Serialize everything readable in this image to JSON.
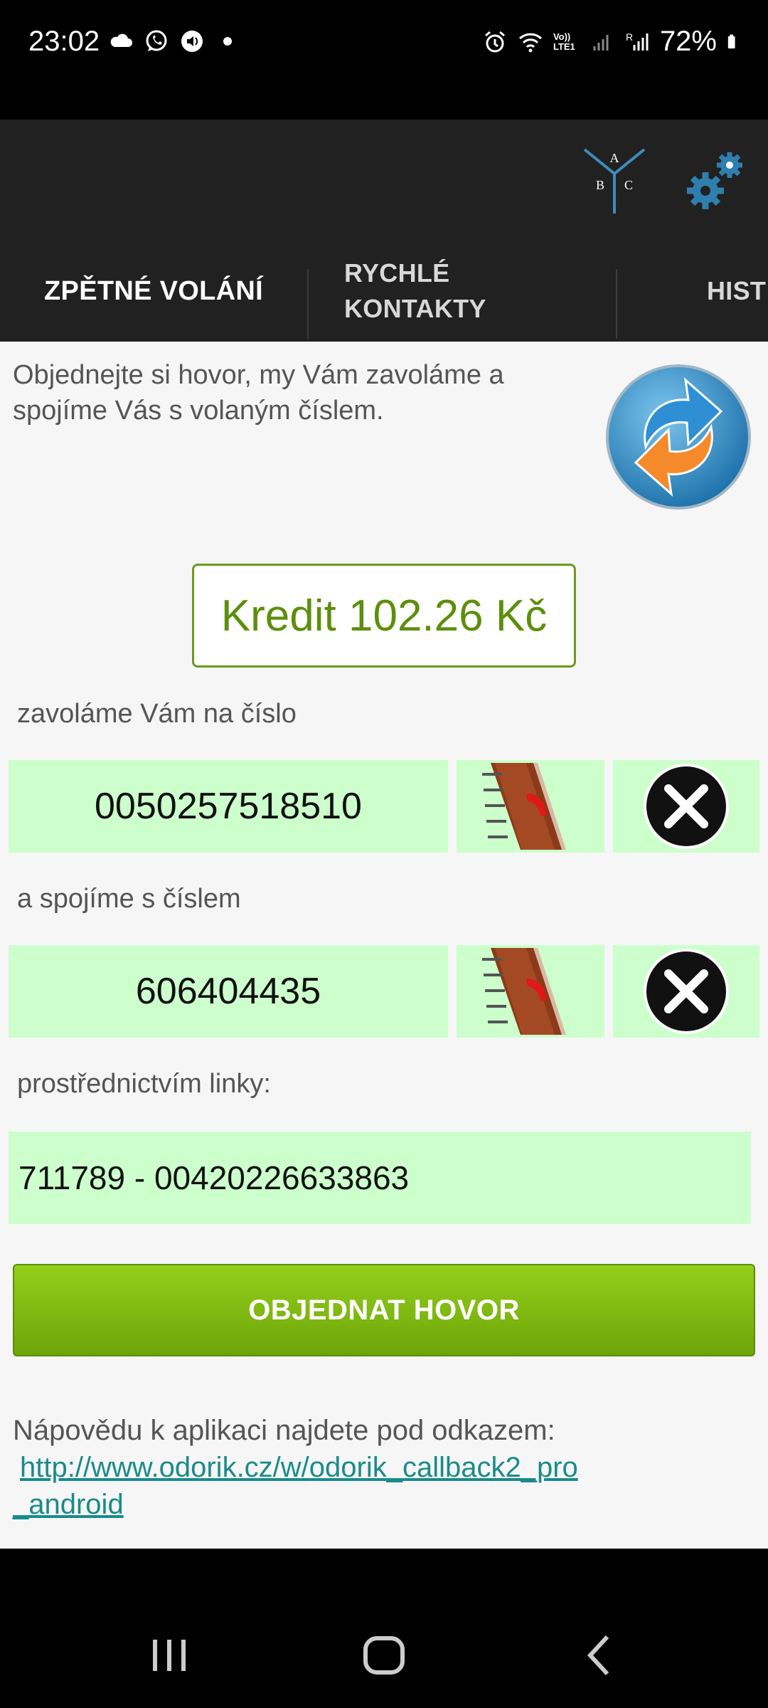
{
  "status_bar": {
    "time": "23:02",
    "battery": "72%",
    "icons_left": [
      "cloud-icon",
      "whatsapp-icon",
      "volume-icon",
      "dot-icon"
    ],
    "icons_right": [
      "alarm-icon",
      "wifi-icon",
      "volte-icon",
      "signal-icon",
      "signal-r-icon",
      "battery-icon"
    ],
    "volte_text": "Vo)) LTE1"
  },
  "app_bar": {
    "abc_icon": {
      "a": "A",
      "b": "B",
      "c": "C"
    }
  },
  "tabs": [
    {
      "label": "ZPĚTNÉ VOLÁNÍ",
      "active": true
    },
    {
      "label": "RYCHLÉ KONTAKTY",
      "line1": "RYCHLÉ",
      "line2": "KONTAKTY",
      "active": false
    },
    {
      "label": "HIST",
      "active": false
    }
  ],
  "main": {
    "intro": "Objednejte si hovor, my Vám zavoláme a spojíme Vás s volaným číslem.",
    "credit": "Kredit 102.26 Kč",
    "label_call_to": "zavoláme Vám na číslo",
    "call_to_number": "0050257518510",
    "label_connect_with": "a spojíme s číslem",
    "connect_number": "606404435",
    "label_line": "prostřednictvím linky:",
    "line_value": "711789 - 00420226633863",
    "order_button": "OBJEDNAT HOVOR",
    "help_text": "Nápovědu k aplikaci najdete pod odkazem:",
    "help_link_line1": "http://www.odorik.cz/w/odorik_callback2_pro",
    "help_link_line2": "_android"
  },
  "colors": {
    "appbar": "#212121",
    "tab_indicator": "#4ba3ad",
    "field_bg": "#ccffcc",
    "credit_green": "#5c8f0c",
    "button_green": "#7cb912",
    "link": "#1a8b8b"
  }
}
